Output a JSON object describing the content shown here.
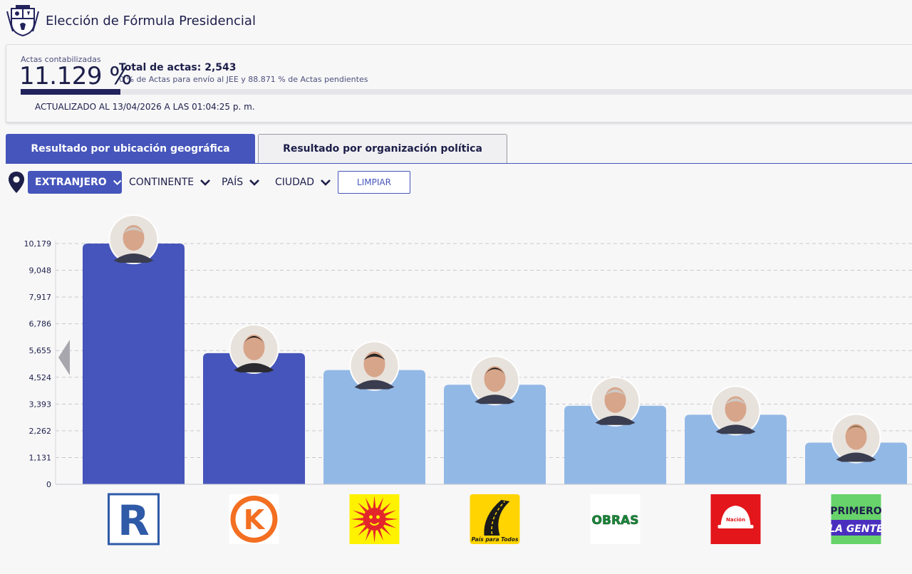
{
  "header": {
    "title": "Elección de Fórmula Presidencial",
    "logo_icon": "peru-coat-of-arms-icon"
  },
  "stats": {
    "actas_label": "Actas contabilizadas",
    "actas_percent": "11.129 %",
    "actas_fraction": 0.11129,
    "total_actas": "Total de actas: 2,543",
    "pending_note": "0 % de Actas para envío al JEE y 88.871 % de Actas pendientes",
    "updated": "ACTUALIZADO AL 13/04/2026 A LAS 01:04:25 p. m."
  },
  "tabs": [
    {
      "label": "Resultado por ubicación geográfica",
      "active": true
    },
    {
      "label": "Resultado por organización política",
      "active": false
    }
  ],
  "filters": {
    "location_icon": "map-pin-icon",
    "scope": "EXTRANJERO",
    "continent": "CONTINENTE",
    "country": "PAÍS",
    "city": "CIUDAD",
    "clear": "LIMPIAR"
  },
  "colors": {
    "accent": "#4555bb",
    "highlight_bar": "#4555bb",
    "bar": "#92b8e6",
    "dark": "#1d1f4a"
  },
  "chart_data": {
    "type": "bar",
    "title": "",
    "xlabel": "",
    "ylabel": "",
    "yticks": [
      "0",
      "1,131",
      "2,262",
      "3,393",
      "4,524",
      "5,655",
      "6,786",
      "7,917",
      "9,048",
      "10,179"
    ],
    "ylim": [
      0,
      10179
    ],
    "grid": true,
    "categories": [
      "R",
      "K",
      "Sun",
      "Road",
      "OBRAS",
      "Helmet",
      "PRIMERO LA GENTE"
    ],
    "values": [
      10179,
      5545,
      4830,
      4210,
      3320,
      2940,
      1760
    ],
    "highlighted": [
      true,
      true,
      false,
      false,
      false,
      false,
      false
    ],
    "logos": [
      {
        "icon": "renovacion-popular-r-logo",
        "text": "R"
      },
      {
        "icon": "fuerza-popular-k-logo",
        "text": "K"
      },
      {
        "icon": "sun-party-logo",
        "text": ""
      },
      {
        "icon": "pais-para-todos-road-logo",
        "text": "País para Todos"
      },
      {
        "icon": "obras-logo",
        "text": "OBRAS"
      },
      {
        "icon": "helmet-party-logo",
        "text": "Nación"
      },
      {
        "icon": "primero-la-gente-logo",
        "text": "PRIMERO LA GENTE"
      }
    ],
    "portraits": [
      "candidate-1-photo",
      "candidate-2-photo",
      "candidate-3-photo",
      "candidate-4-photo",
      "candidate-5-photo",
      "candidate-6-photo",
      "candidate-7-photo"
    ]
  }
}
